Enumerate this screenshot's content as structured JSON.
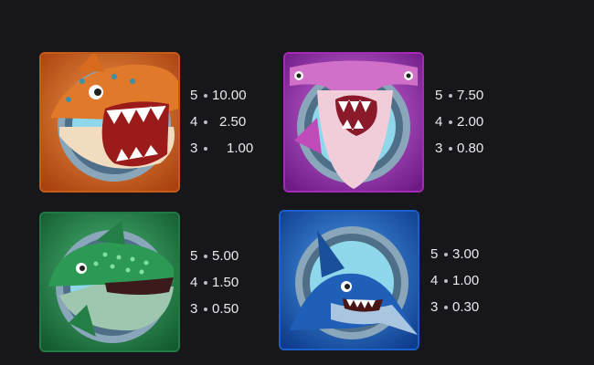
{
  "symbols": [
    {
      "icon": "orange-shark-icon",
      "color": "#e0731f",
      "payouts": [
        {
          "count": "5",
          "value": "10.00"
        },
        {
          "count": "4",
          "value": "2.50"
        },
        {
          "count": "3",
          "value": "1.00"
        }
      ]
    },
    {
      "icon": "hammerhead-shark-icon",
      "color": "#b63ad0",
      "payouts": [
        {
          "count": "5",
          "value": "7.50"
        },
        {
          "count": "4",
          "value": "2.00"
        },
        {
          "count": "3",
          "value": "0.80"
        }
      ]
    },
    {
      "icon": "green-whale-shark-icon",
      "color": "#27944f",
      "payouts": [
        {
          "count": "5",
          "value": "5.00"
        },
        {
          "count": "4",
          "value": "1.50"
        },
        {
          "count": "3",
          "value": "0.50"
        }
      ]
    },
    {
      "icon": "blue-swordfish-icon",
      "color": "#1f6fe0",
      "payouts": [
        {
          "count": "5",
          "value": "3.00"
        },
        {
          "count": "4",
          "value": "1.00"
        },
        {
          "count": "3",
          "value": "0.30"
        }
      ]
    }
  ]
}
